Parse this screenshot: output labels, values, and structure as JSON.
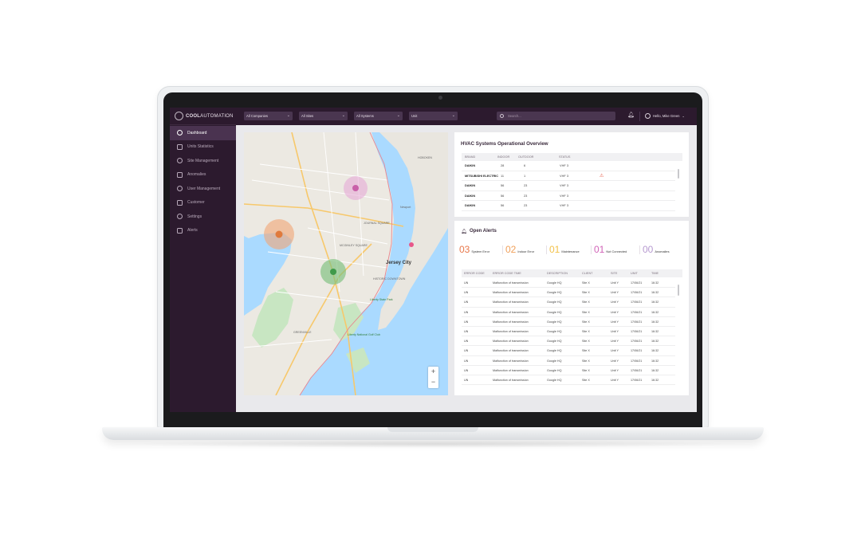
{
  "app": {
    "logo_bold": "COOL",
    "logo_rest": "AUTOMATION"
  },
  "sidebar": {
    "items": [
      {
        "label": "Dashboard",
        "icon": "dashboard-icon",
        "active": true
      },
      {
        "label": "Units Statistics",
        "icon": "bar-chart-icon",
        "active": false
      },
      {
        "label": "Site Management",
        "icon": "building-icon",
        "active": false
      },
      {
        "label": "Anomalies",
        "icon": "pulse-icon",
        "active": false
      },
      {
        "label": "User Management",
        "icon": "user-icon",
        "active": false
      },
      {
        "label": "Customer",
        "icon": "customer-icon",
        "active": false
      },
      {
        "label": "Settings",
        "icon": "gear-icon",
        "active": false
      },
      {
        "label": "Alerts",
        "icon": "bell-icon",
        "active": false
      }
    ]
  },
  "topbar": {
    "filters": [
      "All Companies",
      "All Sites",
      "All Systems",
      "Unit"
    ],
    "search_placeholder": "Search...",
    "user_greeting": "Hello, Mike Green"
  },
  "map": {
    "labels": [
      "Jersey City",
      "JOURNAL SQUARE",
      "MCGINLEY SQUARE",
      "HISTORIC DOWNTOWN",
      "GREENVILLE",
      "Liberty State Park",
      "Liberty National Golf Club",
      "Newport",
      "HOBOKEN"
    ],
    "zoom_in": "+",
    "zoom_out": "−"
  },
  "hvac": {
    "title": "HVAC Systems Operational Overview",
    "columns": [
      "BRAND",
      "INDOOR",
      "OUTDOOR",
      "STATUS"
    ],
    "rows": [
      {
        "brand": "DAIKIN",
        "indoor": "28",
        "outdoor": "6",
        "status": "VHF 3",
        "warning": false
      },
      {
        "brand": "MITSUBISHI ELECTRIC",
        "indoor": "11",
        "outdoor": "1",
        "status": "VHF 3",
        "warning": true
      },
      {
        "brand": "DAIKIN",
        "indoor": "56",
        "outdoor": "23",
        "status": "VHF 3",
        "warning": false
      },
      {
        "brand": "DAIKIN",
        "indoor": "56",
        "outdoor": "23",
        "status": "VHF 3",
        "warning": false
      },
      {
        "brand": "DAIKIN",
        "indoor": "56",
        "outdoor": "23",
        "status": "VHF 3",
        "warning": false
      }
    ]
  },
  "alerts": {
    "title": "Open Alerts",
    "stats": [
      {
        "count": "03",
        "label": "System Error",
        "color": "#e8774a"
      },
      {
        "count": "02",
        "label": "Indoor Error",
        "color": "#f0a05a"
      },
      {
        "count": "01",
        "label": "Maintenance",
        "color": "#f2c24a"
      },
      {
        "count": "01",
        "label": "Not Connected",
        "color": "#d163b8"
      },
      {
        "count": "00",
        "label": "Anomalies",
        "color": "#b79ad0"
      }
    ],
    "columns": [
      "ERROR CODE",
      "ERROR CODE TIME",
      "DESCRIPTION",
      "CLIENT",
      "SITE",
      "UNIT",
      "TIME"
    ],
    "rows": [
      {
        "code": "UN",
        "desc": "Malfunction of transmission",
        "client": "Google HQ",
        "site": "Site X",
        "unit": "Unit Y",
        "date": "17/06/21",
        "time": "16:32"
      },
      {
        "code": "UN",
        "desc": "Malfunction of transmission",
        "client": "Google HQ",
        "site": "Site X",
        "unit": "Unit Y",
        "date": "17/06/21",
        "time": "16:32"
      },
      {
        "code": "UN",
        "desc": "Malfunction of transmission",
        "client": "Google HQ",
        "site": "Site X",
        "unit": "Unit Y",
        "date": "17/06/21",
        "time": "16:32"
      },
      {
        "code": "UN",
        "desc": "Malfunction of transmission",
        "client": "Google HQ",
        "site": "Site X",
        "unit": "Unit Y",
        "date": "17/06/21",
        "time": "16:32"
      },
      {
        "code": "UN",
        "desc": "Malfunction of transmission",
        "client": "Google HQ",
        "site": "Site X",
        "unit": "Unit Y",
        "date": "17/06/21",
        "time": "16:32"
      },
      {
        "code": "UN",
        "desc": "Malfunction of transmission",
        "client": "Google HQ",
        "site": "Site X",
        "unit": "Unit Y",
        "date": "17/06/21",
        "time": "16:32"
      },
      {
        "code": "UN",
        "desc": "Malfunction of transmission",
        "client": "Google HQ",
        "site": "Site X",
        "unit": "Unit Y",
        "date": "17/06/21",
        "time": "16:32"
      },
      {
        "code": "UN",
        "desc": "Malfunction of transmission",
        "client": "Google HQ",
        "site": "Site X",
        "unit": "Unit Y",
        "date": "17/06/21",
        "time": "16:32"
      },
      {
        "code": "UN",
        "desc": "Malfunction of transmission",
        "client": "Google HQ",
        "site": "Site X",
        "unit": "Unit Y",
        "date": "17/06/21",
        "time": "16:32"
      },
      {
        "code": "UN",
        "desc": "Malfunction of transmission",
        "client": "Google HQ",
        "site": "Site X",
        "unit": "Unit Y",
        "date": "17/06/21",
        "time": "16:32"
      },
      {
        "code": "UN",
        "desc": "Malfunction of transmission",
        "client": "Google HQ",
        "site": "Site X",
        "unit": "Unit Y",
        "date": "17/06/21",
        "time": "16:32"
      }
    ]
  }
}
